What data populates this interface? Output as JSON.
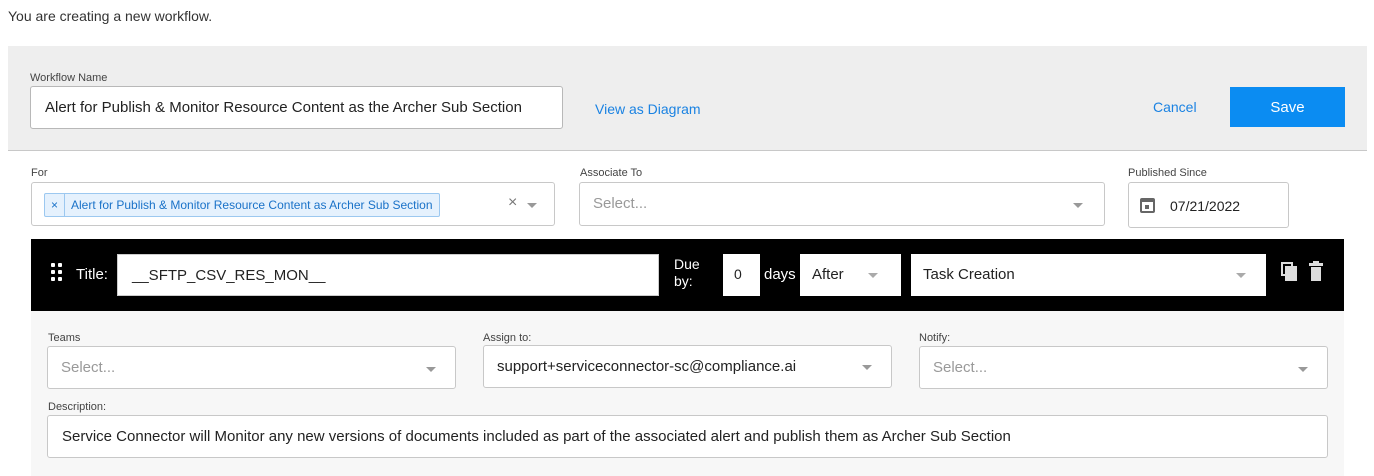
{
  "intro_text": "You are creating a new workflow.",
  "header": {
    "workflow_name_label": "Workflow Name",
    "workflow_name_value": "Alert for Publish & Monitor Resource Content as the Archer Sub Section",
    "view_as_diagram": "View as Diagram",
    "cancel_label": "Cancel",
    "save_label": "Save"
  },
  "filters": {
    "for_label": "For",
    "for_chip_remove": "×",
    "for_chip": "Alert for Publish & Monitor Resource Content as Archer Sub Section",
    "clear_symbol": "×",
    "associate_label": "Associate To",
    "associate_placeholder": "Select...",
    "published_since_label": "Published Since",
    "published_since_value": "07/21/2022"
  },
  "task": {
    "title_label": "Title:",
    "title_value": "__SFTP_CSV_RES_MON__",
    "due_label": "Due by:",
    "due_value": "0",
    "days_label": "days",
    "relation_value": "After",
    "event_value": "Task Creation",
    "teams_label": "Teams",
    "teams_placeholder": "Select...",
    "assign_label": "Assign to:",
    "assign_value": "support+serviceconnector-sc@compliance.ai",
    "notify_label": "Notify:",
    "notify_placeholder": "Select...",
    "description_label": "Description:",
    "description_value": "Service Connector will Monitor any new versions of documents included as part of the associated alert and publish them as Archer Sub Section"
  },
  "icons": {
    "drag": "drag-handle-icon",
    "copy": "copy-icon",
    "delete": "trash-icon",
    "calendar": "calendar-icon"
  },
  "colors": {
    "accent": "#0b8cf2",
    "link": "#1a82e2",
    "task_bar": "#000000",
    "header_band": "#eeeeee"
  }
}
